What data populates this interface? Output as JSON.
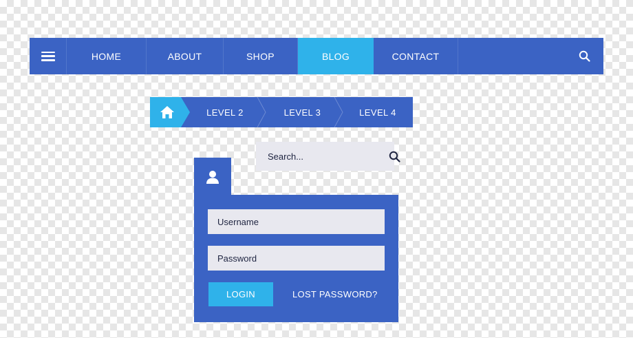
{
  "colors": {
    "primary": "#3b63c4",
    "accent": "#2fb2ea",
    "field_bg": "#e8e8ef"
  },
  "navbar": {
    "menu_icon": "hamburger-menu-icon",
    "items": [
      {
        "label": "HOME",
        "active": false
      },
      {
        "label": "ABOUT",
        "active": false
      },
      {
        "label": "SHOP",
        "active": false
      },
      {
        "label": "BLOG",
        "active": true
      },
      {
        "label": "CONTACT",
        "active": false
      }
    ],
    "search_icon": "search-icon"
  },
  "breadcrumb": {
    "home_icon": "home-icon",
    "levels": [
      "LEVEL  2",
      "LEVEL  3",
      "LEVEL  4"
    ]
  },
  "search": {
    "placeholder": "Search...",
    "icon": "search-icon"
  },
  "login": {
    "user_icon": "user-icon",
    "username_placeholder": "Username",
    "password_placeholder": "Password",
    "login_label": "LOGIN",
    "lost_password_label": "LOST PASSWORD?"
  }
}
